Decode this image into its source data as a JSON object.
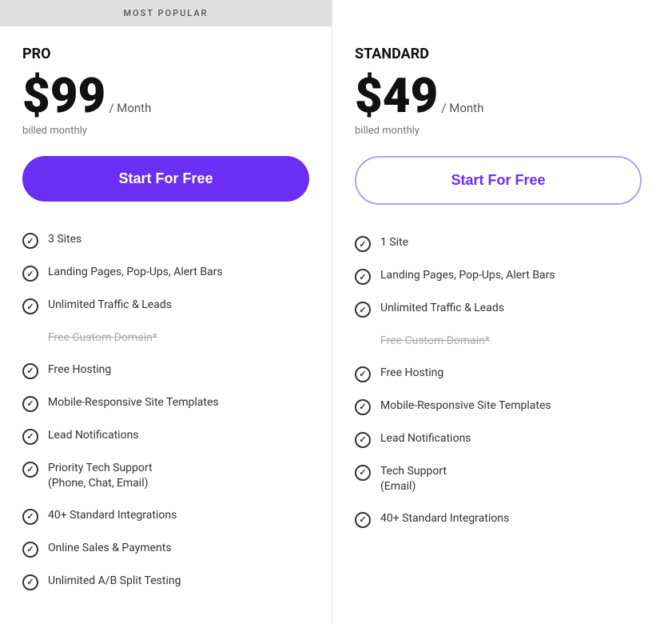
{
  "plans": [
    {
      "id": "pro",
      "badge": "MOST POPULAR",
      "name": "PRO",
      "price": "$99",
      "period": "/ Month",
      "billing": "billed monthly",
      "cta_label": "Start For Free",
      "cta_style": "filled",
      "features": [
        {
          "text": "3 Sites",
          "strikethrough": false,
          "has_icon": true
        },
        {
          "text": "Landing Pages, Pop-Ups, Alert Bars",
          "strikethrough": false,
          "has_icon": true
        },
        {
          "text": "Unlimited Traffic & Leads",
          "strikethrough": false,
          "has_icon": true
        },
        {
          "text": "Free Custom Domain*",
          "strikethrough": true,
          "has_icon": false
        },
        {
          "text": "Free Hosting",
          "strikethrough": false,
          "has_icon": true
        },
        {
          "text": "Mobile-Responsive Site Templates",
          "strikethrough": false,
          "has_icon": true
        },
        {
          "text": "Lead Notifications",
          "strikethrough": false,
          "has_icon": true
        },
        {
          "text": "Priority Tech Support\n(Phone, Chat, Email)",
          "strikethrough": false,
          "has_icon": true
        },
        {
          "text": "40+ Standard Integrations",
          "strikethrough": false,
          "has_icon": true
        },
        {
          "text": "Online Sales & Payments",
          "strikethrough": false,
          "has_icon": true
        },
        {
          "text": "Unlimited A/B Split Testing",
          "strikethrough": false,
          "has_icon": true
        }
      ]
    },
    {
      "id": "standard",
      "badge": "",
      "name": "STANDARD",
      "price": "$49",
      "period": "/ Month",
      "billing": "billed monthly",
      "cta_label": "Start For Free",
      "cta_style": "outline",
      "features": [
        {
          "text": "1 Site",
          "strikethrough": false,
          "has_icon": true
        },
        {
          "text": "Landing Pages, Pop-Ups, Alert Bars",
          "strikethrough": false,
          "has_icon": true
        },
        {
          "text": "Unlimited Traffic & Leads",
          "strikethrough": false,
          "has_icon": true
        },
        {
          "text": "Free Custom Domain*",
          "strikethrough": true,
          "has_icon": false
        },
        {
          "text": "Free Hosting",
          "strikethrough": false,
          "has_icon": true
        },
        {
          "text": "Mobile-Responsive Site Templates",
          "strikethrough": false,
          "has_icon": true
        },
        {
          "text": "Lead Notifications",
          "strikethrough": false,
          "has_icon": true
        },
        {
          "text": "Tech Support\n(Email)",
          "strikethrough": false,
          "has_icon": true
        },
        {
          "text": "40+ Standard Integrations",
          "strikethrough": false,
          "has_icon": true
        }
      ]
    }
  ],
  "colors": {
    "accent": "#6b2ef5",
    "accent_border": "#b89eee"
  }
}
